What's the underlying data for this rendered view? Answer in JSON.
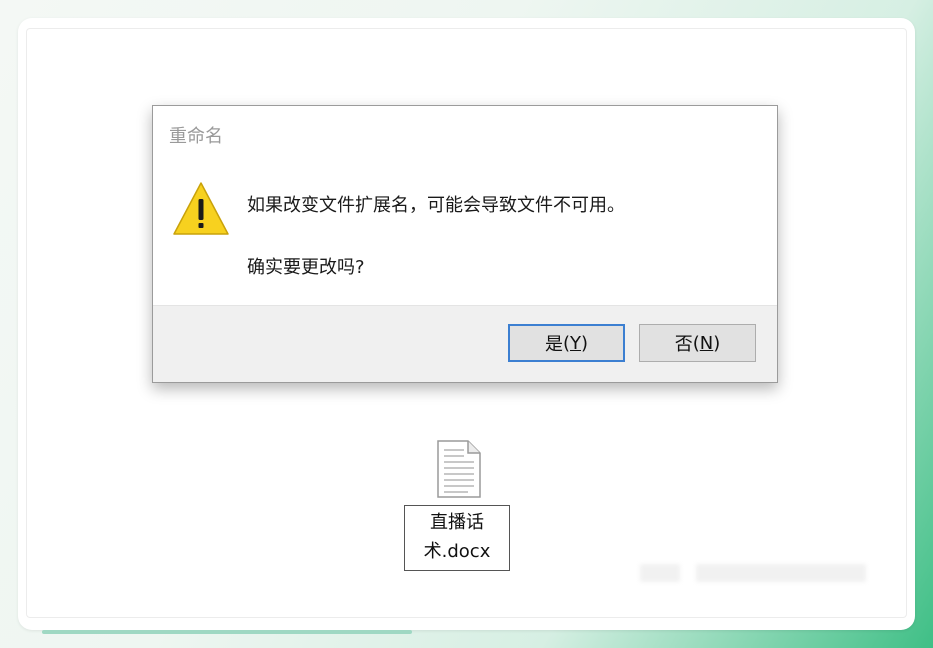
{
  "dialog": {
    "title": "重命名",
    "warning_icon": "warning-triangle-icon",
    "message_line1": "如果改变文件扩展名，可能会导致文件不可用。",
    "message_line2": "确实要更改吗?",
    "yes_button": {
      "label": "是",
      "mnemonic": "Y"
    },
    "no_button": {
      "label": "否",
      "mnemonic": "N"
    }
  },
  "file": {
    "icon": "document-file-icon",
    "name_line1": "直播话",
    "name_line2": "术.docx"
  },
  "colors": {
    "warning_yellow": "#f7d11f",
    "focus_blue": "#3c7fd1",
    "button_bar_bg": "#f0f0f0"
  }
}
